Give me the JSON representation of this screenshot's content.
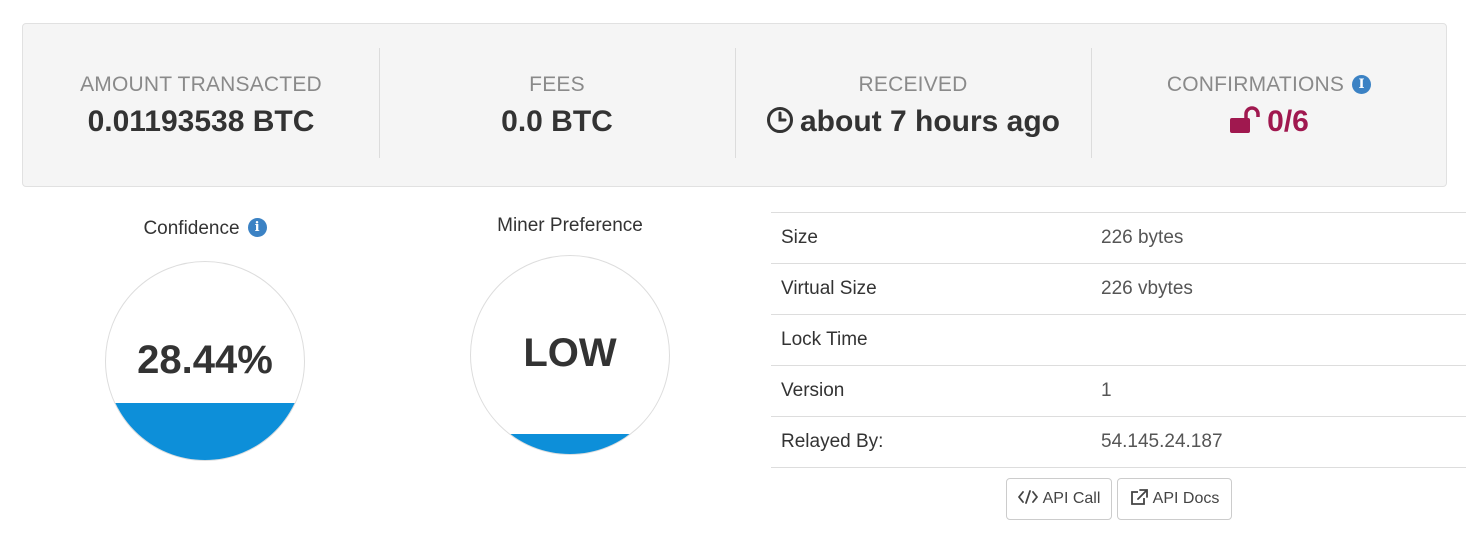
{
  "summary": {
    "amount": {
      "label": "AMOUNT TRANSACTED",
      "value": "0.01193538 BTC"
    },
    "fees": {
      "label": "FEES",
      "value": "0.0 BTC"
    },
    "received": {
      "label": "RECEIVED",
      "value": "about 7 hours ago",
      "icon": "clock-icon"
    },
    "confirmations": {
      "label": "CONFIRMATIONS",
      "value": "0/6",
      "icon": "unlock-icon",
      "info_icon": "info-icon",
      "color": "#a0184f"
    }
  },
  "confidence": {
    "title": "Confidence",
    "value": "28.44%",
    "fill_fraction": 0.2844,
    "info_icon": "info-icon",
    "fill_color": "#0d8fd9"
  },
  "miner_preference": {
    "title": "Miner Preference",
    "value": "LOW",
    "fill_color": "#0d8fd9"
  },
  "details": {
    "rows": [
      {
        "key": "Size",
        "value": "226 bytes"
      },
      {
        "key": "Virtual Size",
        "value": "226 vbytes"
      },
      {
        "key": "Lock Time",
        "value": ""
      },
      {
        "key": "Version",
        "value": "1"
      },
      {
        "key": "Relayed By:",
        "value": "54.145.24.187"
      }
    ]
  },
  "buttons": {
    "api_call": {
      "label": "API Call",
      "icon": "code-icon"
    },
    "api_docs": {
      "label": "API Docs",
      "icon": "external-link-icon"
    }
  }
}
